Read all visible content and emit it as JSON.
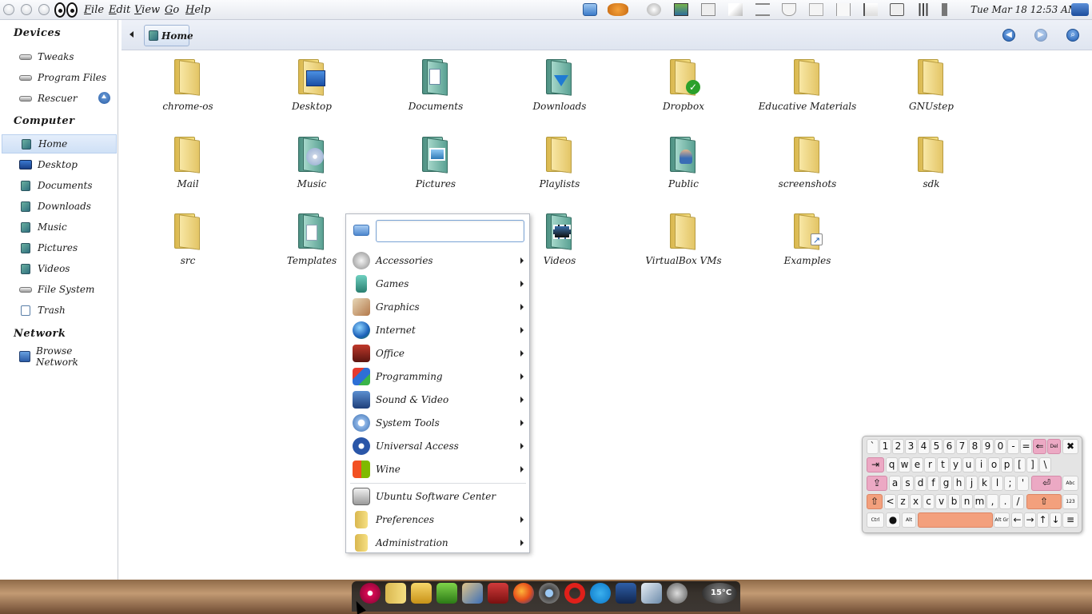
{
  "top_panel": {
    "menus": [
      "File",
      "Edit",
      "View",
      "Go",
      "Help"
    ],
    "clock": "Tue Mar 18 12:53 AM"
  },
  "sidebar": {
    "devices_header": "Devices",
    "devices": [
      "Tweaks",
      "Program Files",
      "Rescuer"
    ],
    "computer_header": "Computer",
    "computer": [
      "Home",
      "Desktop",
      "Documents",
      "Downloads",
      "Music",
      "Pictures",
      "Videos",
      "File System",
      "Trash"
    ],
    "network_header": "Network",
    "network": [
      "Browse Network"
    ]
  },
  "toolbar": {
    "breadcrumb": "Home"
  },
  "files": [
    "chrome-os",
    "Desktop",
    "Documents",
    "Downloads",
    "Dropbox",
    "Educative Materials",
    "GNUstep",
    "Mail",
    "Music",
    "Pictures",
    "Playlists",
    "Public",
    "screenshots",
    "sdk",
    "src",
    "Templates",
    "Videos",
    "VirtualBox VMs",
    "Examples"
  ],
  "app_menu": {
    "search_value": "",
    "items": [
      "Accessories",
      "Games",
      "Graphics",
      "Internet",
      "Office",
      "Programming",
      "Sound & Video",
      "System Tools",
      "Universal Access",
      "Wine"
    ],
    "items2": [
      "Ubuntu Software Center",
      "Preferences",
      "Administration"
    ]
  },
  "dock": {
    "weather": "15°C"
  },
  "keyboard": {
    "row1": [
      "`",
      "1",
      "2",
      "3",
      "4",
      "5",
      "6",
      "7",
      "8",
      "9",
      "0",
      "-",
      "="
    ],
    "row2": [
      "q",
      "w",
      "e",
      "r",
      "t",
      "y",
      "u",
      "i",
      "o",
      "p",
      "[",
      "]",
      "\\"
    ],
    "row3": [
      "a",
      "s",
      "d",
      "f",
      "g",
      "h",
      "j",
      "k",
      "l",
      ";",
      "'"
    ],
    "row4": [
      "<",
      "z",
      "x",
      "c",
      "v",
      "b",
      "n",
      "m",
      ",",
      ".",
      "/"
    ],
    "backspace": "⇐",
    "del": "Del",
    "close": "✖",
    "tab": "⇥",
    "enter": "⏎",
    "shift": "⇧",
    "abc": "Abc",
    "num": "123",
    "ctrl": "Ctrl",
    "alt": "Alt",
    "altgr": "Alt Gr",
    "arrows": [
      "←",
      "→",
      "↑",
      "↓"
    ],
    "menu": "≡",
    "caps": "⇪"
  }
}
